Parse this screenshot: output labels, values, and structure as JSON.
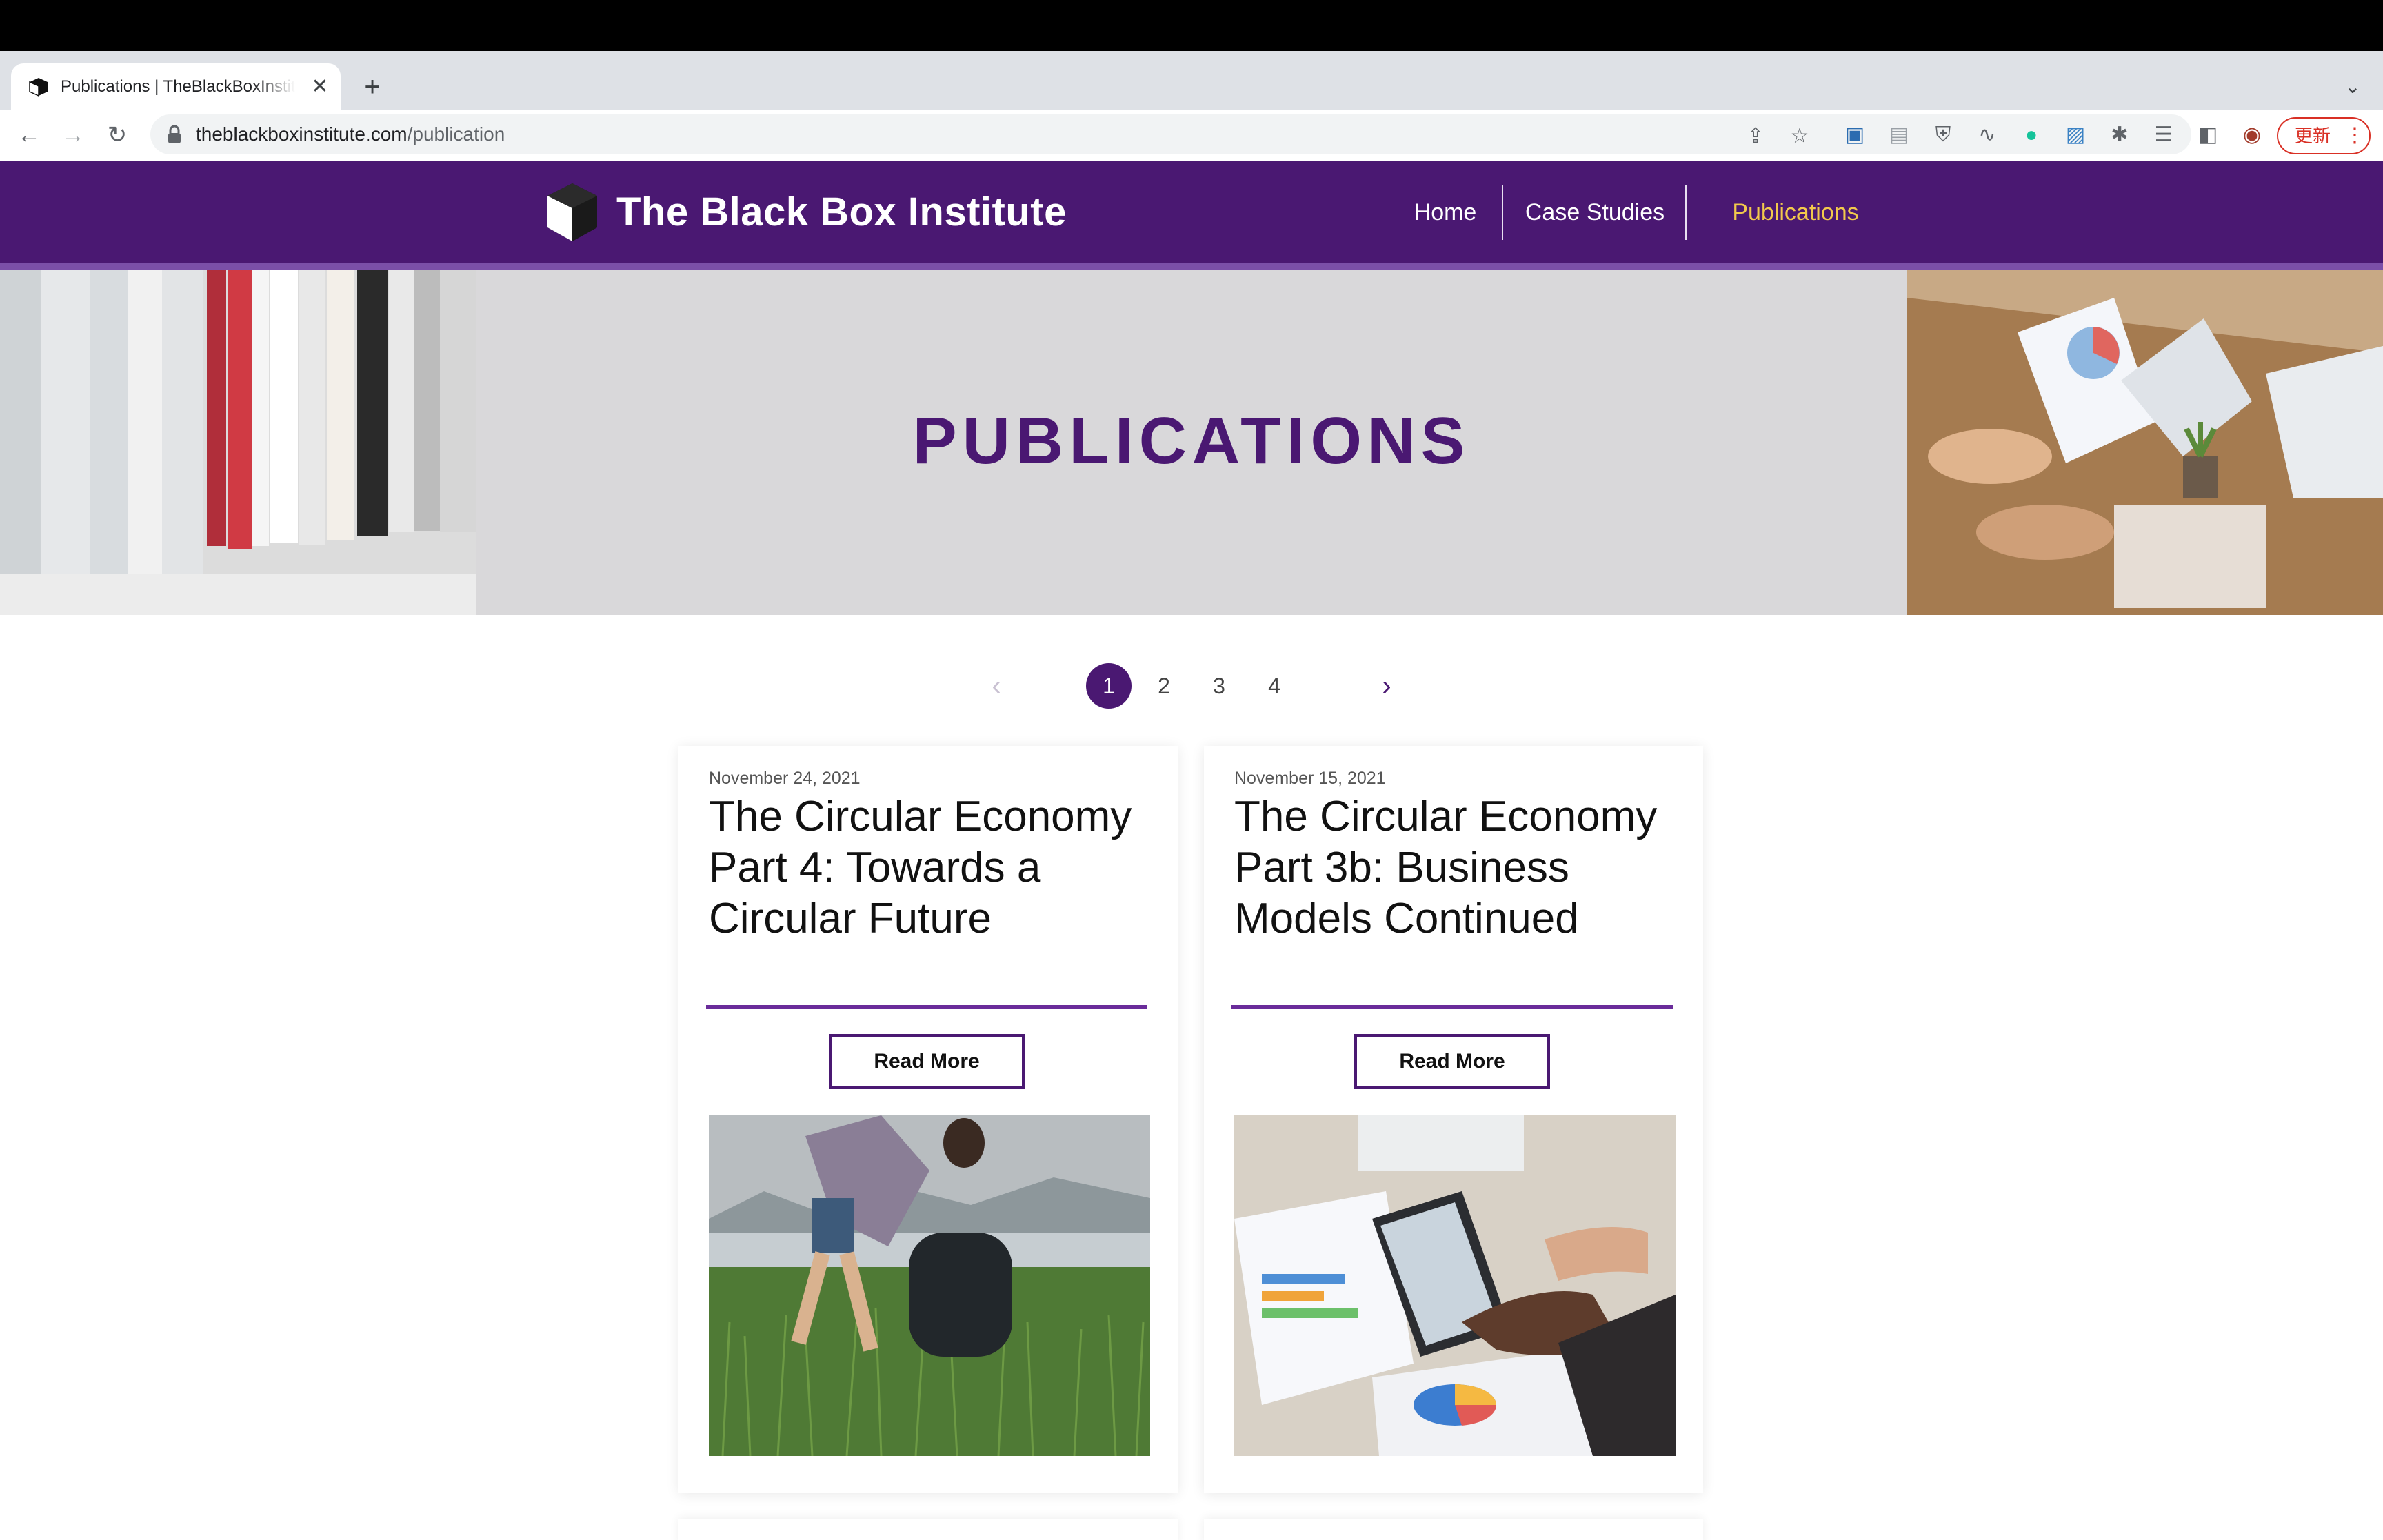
{
  "browser": {
    "tab_title": "Publications | TheBlackBoxInstitute",
    "tab_close": "✕",
    "new_tab": "+",
    "url_host": "theblackboxinstitute.com",
    "url_path": "/publication",
    "update_label": "更新"
  },
  "site": {
    "brand": "The Black Box Institute",
    "nav": [
      {
        "label": "Home",
        "active": false
      },
      {
        "label": "Case Studies",
        "active": false
      },
      {
        "label": "Publications",
        "active": true
      }
    ],
    "colors": {
      "brand_purple": "#4a1872",
      "nav_active": "#f2c94c",
      "rule_purple": "#6a2c9a"
    }
  },
  "hero": {
    "title": "PUBLICATIONS"
  },
  "pagination": {
    "prev": "‹",
    "next": "›",
    "pages": [
      "1",
      "2",
      "3",
      "4"
    ],
    "current": "1"
  },
  "cards": [
    {
      "date": "November 24, 2021",
      "title": "The Circular Economy Part 4: Towards a Circular Future",
      "button": "Read More",
      "image": "woman-collecting-litter-in-grass"
    },
    {
      "date": "November 15, 2021",
      "title": "The Circular Economy Part 3b: Business Models Continued",
      "button": "Read More",
      "image": "hands-with-tablet-and-charts"
    }
  ]
}
